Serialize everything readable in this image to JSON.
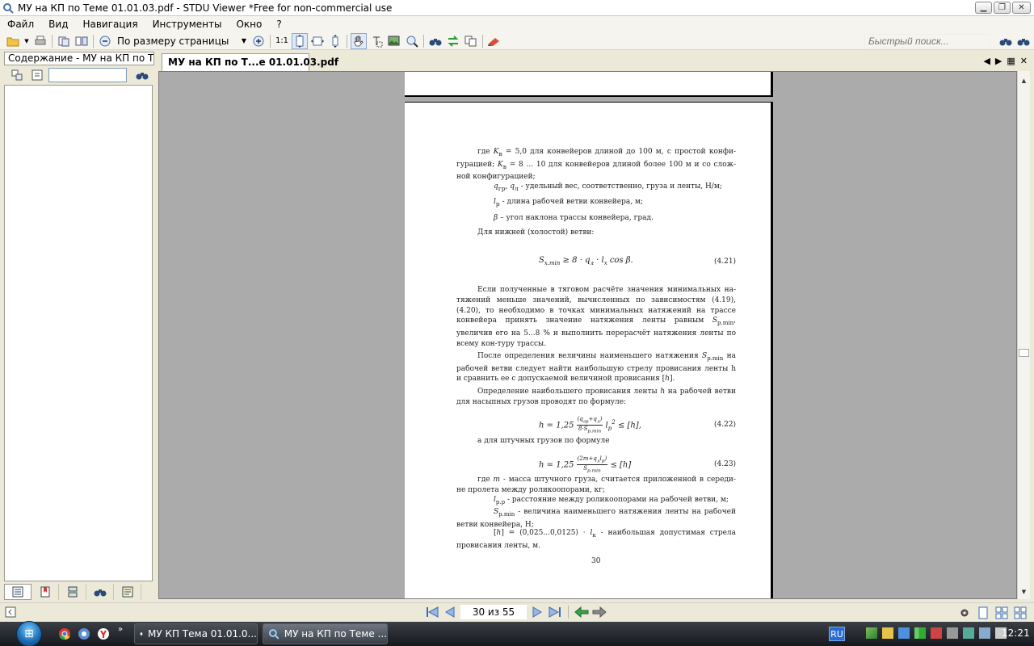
{
  "window": {
    "title": "МУ на КП по Теме 01.01.03.pdf - STDU Viewer *Free for non-commercial use"
  },
  "menu": [
    {
      "label": "Файл"
    },
    {
      "label": "Вид"
    },
    {
      "label": "Навигация"
    },
    {
      "label": "Инструменты"
    },
    {
      "label": "Окно"
    },
    {
      "label": "?"
    }
  ],
  "toolbar": {
    "zoom_mode": "По размеру страницы",
    "one_to_one": "1:1",
    "quick_search_placeholder": "Быстрый поиск..."
  },
  "left_pane": {
    "tab_label": "Содержание - МУ на КП по Теме",
    "search_value": ""
  },
  "document_tab": {
    "label": "МУ на КП по Т...е 01.01.03.pdf"
  },
  "page": {
    "p1": "где K_в = 5,0 для конвейеров длиной до 100 м, с простой конфи­гурацией; K_в = 8 ... 10 для конвейеров длиной более 100 м и со слож­ной конфигурацией;",
    "p1_html_a": "где",
    "p1_html_b": "для конвейеров длиной до 100 м, с простой конфи-гурацией;",
    "p1_html_c": "для конвейеров длиной более 100 м и со слож-ной конфигурацией;",
    "def1": "- удельный вес, соответственно, груза и ленты, Н/м;",
    "def2": "- длина рабочей ветви конвейера, м;",
    "def3": "– угол наклона трассы конвейера, град.",
    "p_lower": "Для нижней (холостой) ветви:",
    "eq421": "(4.21)",
    "p2": "Если полученные в тяговом расчёте значения минимальных на-тяжений меньше значений, вычисленных по зависимостям (4.19), (4.20), то необходимо в точках минимальных натяжений на трассе конвейера принять значение натяжения ленты равным",
    "p2_tail": ", увеличив его на 5...8 % и выполнить перерасчёт натяжения ленты по всему кон-туру трассы.",
    "p3a": "После определения величины наименьшего натяжения",
    "p3b": "на рабочей ветви следует найти наибольшую стрелу провисания ленты h и сравнить ее с допускаемой величиной провисания",
    "p4a": "Определение наибольшего провисания ленты",
    "p4b": "на рабочей ветви для насыпных грузов проводят по формуле:",
    "eq422": "(4.22)",
    "p5": "а для штучных грузов по формуле",
    "eq423": "(4.23)",
    "p6a": "где",
    "p6b": "- масса штучного груза, считается приложенной в середи-не пролета между роликоопорами, кг;",
    "def4": "- расстояние между роликоопорами на рабочей ветви, м;",
    "def5": "- величина наименьшего натяжения ленты на рабочей ветви конвейера, Н;",
    "def6": "- наибольшая допустимая стрела провисания ленты, м.",
    "page_number": "30"
  },
  "navigation": {
    "page_indicator": "30 из 55"
  },
  "taskbar": {
    "items": [
      {
        "label": "МУ КП Тема 01.01.0..."
      },
      {
        "label": "МУ на КП по Теме ..."
      }
    ],
    "language": "RU",
    "clock": "12:21"
  }
}
